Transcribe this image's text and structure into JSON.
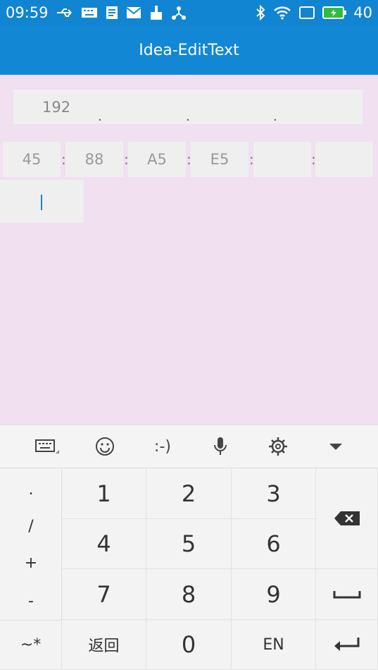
{
  "status_bar": {
    "time": "09:59",
    "battery_level": "40",
    "icons_left": [
      "usb-icon",
      "keyboard-icon",
      "document-icon",
      "mail-icon",
      "cleaner-icon",
      "network-icon"
    ],
    "icons_right": [
      "bluetooth-icon",
      "wifi-icon",
      "screen-icon",
      "battery-icon"
    ]
  },
  "app_bar": {
    "title": "Idea-EditText"
  },
  "ip_field": {
    "value": "192",
    "separators": [
      ".",
      ".",
      "."
    ]
  },
  "mac_field": {
    "segments": [
      "45",
      "88",
      "A5",
      "E5",
      "",
      ""
    ],
    "separator": ":"
  },
  "keyboard": {
    "toolbar": [
      "keyboard-switch-icon",
      "emoji-icon",
      ":-)",
      "mic-icon",
      "settings-icon",
      "collapse-icon"
    ],
    "symbols": [
      ".",
      "/",
      "+",
      "-"
    ],
    "digits": [
      "1",
      "2",
      "3",
      "4",
      "5",
      "6",
      "7",
      "8",
      "9"
    ],
    "bottom_row": {
      "symbols_key": "~*",
      "back_key": "返回",
      "zero_key": "0",
      "lang_key": "EN"
    },
    "action_icons": [
      "backspace-icon",
      "space-icon",
      "enter-icon"
    ]
  },
  "colors": {
    "primary": "#1287d4",
    "background": "#f0e0f0",
    "field": "#efefef"
  }
}
